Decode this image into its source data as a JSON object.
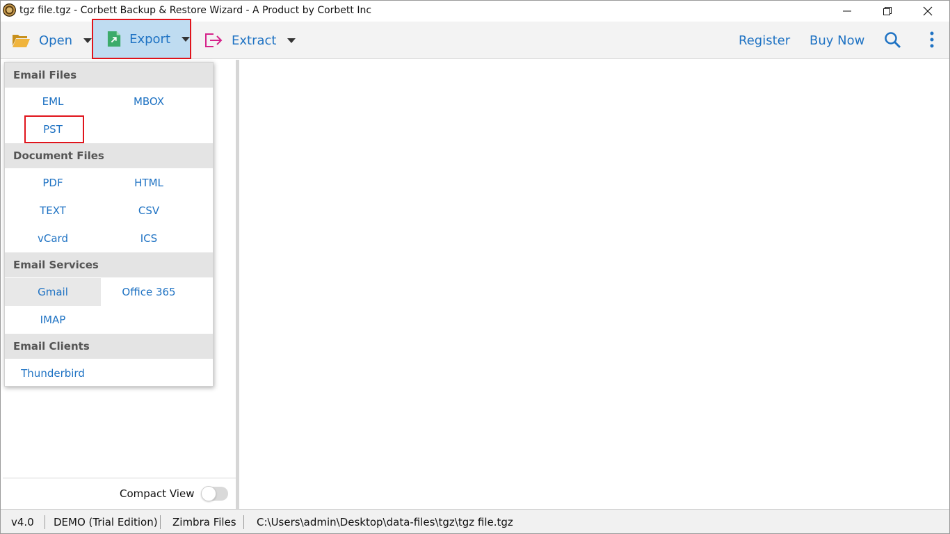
{
  "window": {
    "title": "tgz file.tgz - Corbett Backup & Restore Wizard - A Product by Corbett Inc"
  },
  "toolbar": {
    "open_label": "Open",
    "export_label": "Export",
    "extract_label": "Extract",
    "register_label": "Register",
    "buynow_label": "Buy Now"
  },
  "export_menu": {
    "sections": [
      {
        "header": "Email Files",
        "items": [
          "EML",
          "MBOX",
          "PST"
        ]
      },
      {
        "header": "Document Files",
        "items": [
          "PDF",
          "HTML",
          "TEXT",
          "CSV",
          "vCard",
          "ICS"
        ]
      },
      {
        "header": "Email Services",
        "items": [
          "Gmail",
          "Office 365",
          "IMAP"
        ]
      },
      {
        "header": "Email Clients",
        "items": [
          "Thunderbird"
        ]
      }
    ]
  },
  "left_panel": {
    "compact_view_label": "Compact View"
  },
  "statusbar": {
    "version": "v4.0",
    "edition": "DEMO (Trial Edition)",
    "file_type": "Zimbra Files",
    "path": "C:\\Users\\admin\\Desktop\\data-files\\tgz\\tgz file.tgz"
  },
  "colors": {
    "accent_blue": "#1e72c3",
    "highlight_red": "#e0141c",
    "export_active_bg": "#bfdcf1"
  },
  "icons": {
    "open": "folder-open-icon",
    "export": "export-file-icon",
    "extract": "extract-arrow-icon",
    "search": "search-icon",
    "more": "more-vertical-icon"
  }
}
